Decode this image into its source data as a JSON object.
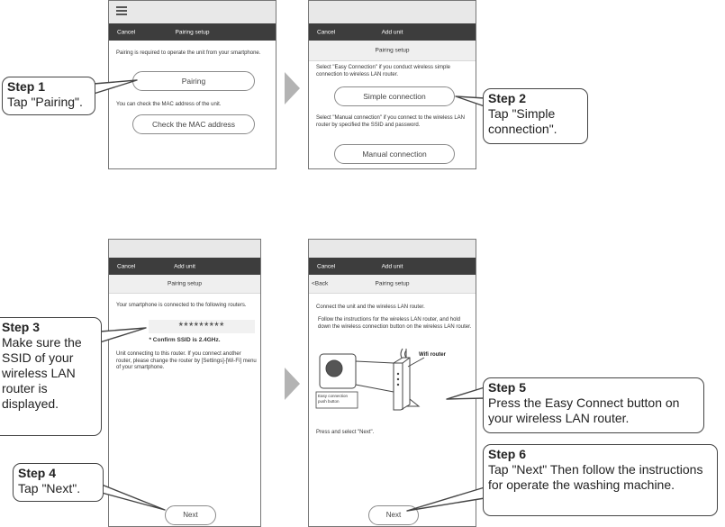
{
  "screen1": {
    "nav_cancel": "Cancel",
    "nav_title": "Pairing setup",
    "intro": "Pairing is required to operate the unit from your smartphone.",
    "pairing_button": "Pairing",
    "mac_text": "You can check the MAC address of the unit.",
    "mac_button": "Check the MAC address"
  },
  "screen2": {
    "nav_cancel": "Cancel",
    "nav_title": "Add unit",
    "sub_title": "Pairing setup",
    "easy_text": "Select \"Easy Connection\" if you conduct wireless simple connection to wireless LAN router.",
    "simple_button": "Simple connection",
    "manual_text": "Select \"Manual connection\" if you connect to the wireless LAN router by specified the SSID and password.",
    "manual_button": "Manual connection"
  },
  "screen3": {
    "nav_cancel": "Cancel",
    "nav_title": "Add unit",
    "sub_title": "Pairing setup",
    "connected_text": "Your smartphone is connected to the following routers.",
    "ssid_value": "*********",
    "confirm_note": "* Confirm SSID is 2.4GHz.",
    "info_text": "Unit connecting to this router. If you connect another router, please change the router by [Settings]-[Wi-Fi] menu of your smartphone.",
    "next_button": "Next"
  },
  "screen4": {
    "nav_cancel": "Cancel",
    "nav_title": "Add unit",
    "back_label": "<Back",
    "sub_title": "Pairing setup",
    "connect_text": "Connect the unit and the wireless LAN router.",
    "follow_text": "Follow the instructions for the wireless LAN router, and hold down the wireless connection button on the wireless LAN router.",
    "wifi_router_label": "Wifi router",
    "push_button_label": "Easy connection push button",
    "press_text": "Press and select \"Next\".",
    "next_button": "Next"
  },
  "callouts": {
    "step1": {
      "head": "Step 1",
      "body": "Tap \"Pairing\"."
    },
    "step2": {
      "head": "Step 2",
      "body": "Tap \"Simple connection\"."
    },
    "step3": {
      "head": "Step 3",
      "body": "Make sure the SSID of your wireless LAN router is displayed."
    },
    "step4": {
      "head": "Step 4",
      "body": "Tap \"Next\"."
    },
    "step5": {
      "head": "Step 5",
      "body": "Press the Easy Connect button on your wireless LAN router."
    },
    "step6": {
      "head": "Step 6",
      "body": "Tap \"Next\" Then follow the instructions for operate the washing machine."
    }
  },
  "colors": {
    "navbar": "#3d3d3d",
    "arrow": "#b3b3b3",
    "callout_border": "#444444"
  }
}
